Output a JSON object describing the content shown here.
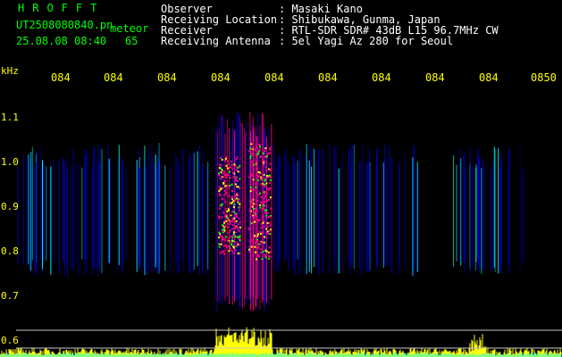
{
  "header": {
    "app_name": "HROFFT",
    "file_name": "UT2508080840.pn",
    "mode_label": "meteor",
    "date_time": "25.08.08 08:40",
    "count": "65",
    "info_labels": [
      "Observer",
      "Receiving Location",
      "Receiver",
      "Receiving Antenna"
    ],
    "info_values": [
      ": Masaki Kano",
      ": Shibukawa, Gunma, Japan",
      ": RTL-SDR SDR# 43dB L15 96.7MHz CW",
      ": 5el Yagi Az 280 for Seoul"
    ]
  },
  "axis": {
    "freq_unit": "kHz",
    "time_ticks": [
      "084",
      "084",
      "084",
      "084",
      "084",
      "084",
      "084",
      "084",
      "084",
      "0850"
    ],
    "freq_ticks": [
      "1.1",
      "1.0",
      "0.9",
      "0.8",
      "0.7",
      "0.6"
    ]
  },
  "colors": {
    "background": "#000000",
    "text": "#ffffff",
    "accent_green": "#00ff00",
    "accent_yellow": "#ffff00",
    "signal_low": "#0000c8",
    "signal_mid": "#00ffff",
    "signal_high": "#ff0080",
    "amplitude_trace": "#ffff00",
    "baseline_trace": "#00ffff"
  }
}
